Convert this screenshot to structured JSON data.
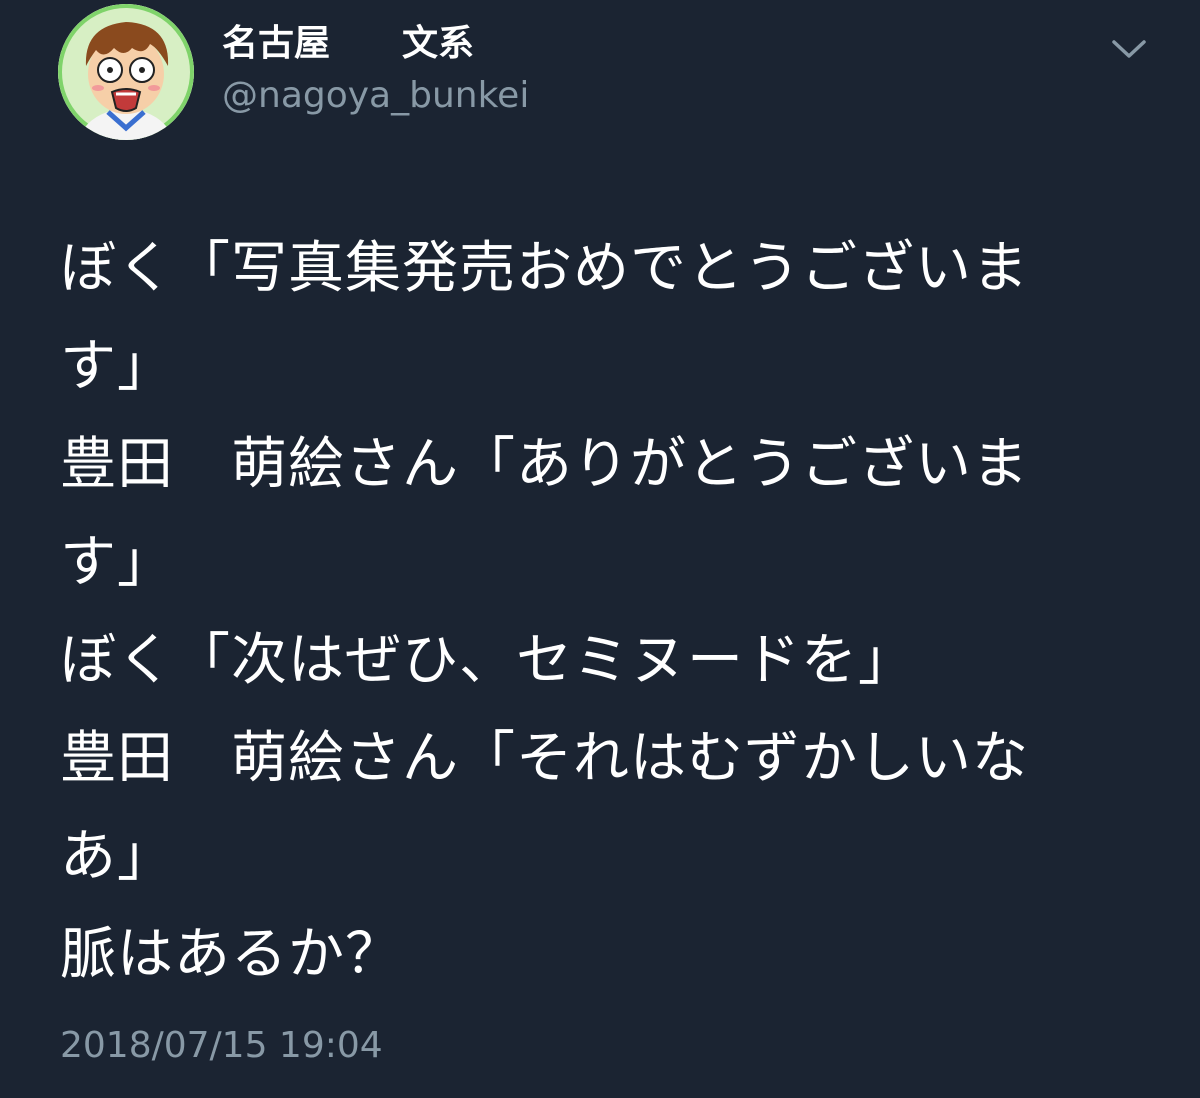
{
  "header": {
    "display_name": "名古屋　　文系",
    "handle": "@nagoya_bunkei",
    "menu_icon": "chevron-down-icon"
  },
  "avatar": {
    "icon": "avatar-cartoon-boy"
  },
  "tweet": {
    "lines": [
      "ぼく「写真集発売おめでとうございま",
      "す」",
      "豊田　萌絵さん「ありがとうございま",
      "す」",
      "ぼく「次はぜひ、セミヌードを」",
      "豊田　萌絵さん「それはむずかしいな",
      "あ」",
      "脈はあるか？"
    ],
    "timestamp": "2018/07/15 19:04"
  },
  "colors": {
    "background": "#1b2432",
    "text_primary": "#ffffff",
    "text_secondary": "#8899a6"
  }
}
